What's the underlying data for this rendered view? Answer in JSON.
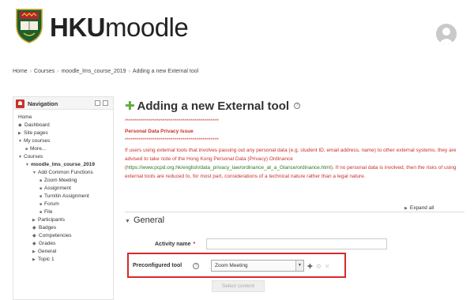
{
  "header": {
    "brand_bold": "HKU",
    "brand_light": "moodle",
    "crest_icon": "hku-crest-icon",
    "avatar_icon": "user-avatar-icon"
  },
  "breadcrumb": [
    "Home",
    "Courses",
    "moodle_lms_course_2019",
    "Adding a new External tool"
  ],
  "navigation": {
    "title": "Navigation",
    "items": [
      {
        "label": "Home",
        "indent": 0,
        "marker": "none"
      },
      {
        "label": "Dashboard",
        "indent": 0,
        "marker": "icon"
      },
      {
        "label": "Site pages",
        "indent": 0,
        "marker": "collapsed"
      },
      {
        "label": "My courses",
        "indent": 0,
        "marker": "expanded"
      },
      {
        "label": "More...",
        "indent": 1,
        "marker": "bullet"
      },
      {
        "label": "Courses",
        "indent": 0,
        "marker": "expanded"
      },
      {
        "label": "moodle_lms_course_2019",
        "indent": 1,
        "marker": "expanded",
        "bold": true
      },
      {
        "label": "Add Common Functions",
        "indent": 2,
        "marker": "expanded"
      },
      {
        "label": "Zoom Meeting",
        "indent": 3,
        "marker": "bullet"
      },
      {
        "label": "Assignment",
        "indent": 3,
        "marker": "bullet"
      },
      {
        "label": "Turnitin Assignment",
        "indent": 3,
        "marker": "bullet"
      },
      {
        "label": "Forum",
        "indent": 3,
        "marker": "bullet"
      },
      {
        "label": "File",
        "indent": 3,
        "marker": "bullet"
      },
      {
        "label": "Participants",
        "indent": 2,
        "marker": "collapsed"
      },
      {
        "label": "Badges",
        "indent": 2,
        "marker": "icon"
      },
      {
        "label": "Competencies",
        "indent": 2,
        "marker": "icon"
      },
      {
        "label": "Grades",
        "indent": 2,
        "marker": "icon"
      },
      {
        "label": "General",
        "indent": 2,
        "marker": "collapsed"
      },
      {
        "label": "Topic 1",
        "indent": 2,
        "marker": "collapsed"
      }
    ]
  },
  "main": {
    "title": "Adding a new External tool",
    "privacy": {
      "stars": "***********************************************",
      "heading": "Personal Data Privacy Issue",
      "stars2": "***********************************************",
      "para_a": "If users using external tools that involves passing out any personal data (e.g. student ID, email address, name) to other external systems, they are advised to take note of the Hong Kong Personal Data (Privacy) Ordinance (",
      "link": "https://www.pcpd.org.hk/english/data_privacy_law/ordinance_at_a_Glance/ordinance.html",
      "para_b": "). If no personal data is involved, then the risks of using external tools are reduced to, for most part, considerations of a technical nature rather than a legal nature."
    },
    "expand_all": "Expand all",
    "section": "General",
    "activity_name_label": "Activity name",
    "required_marker": "*",
    "preconfigured_label": "Preconfigured tool",
    "preconfigured_value": "Zoom Meeting",
    "select_content": "Select content"
  }
}
